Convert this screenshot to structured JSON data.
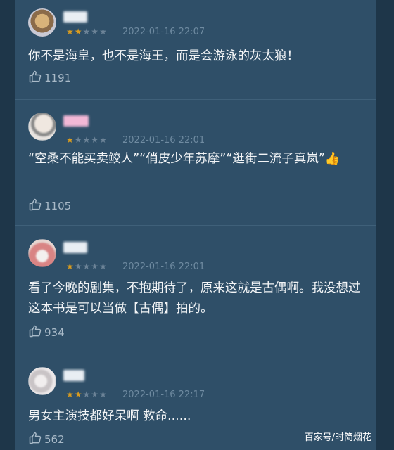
{
  "comments": [
    {
      "rating_filled": 2,
      "rating_total": 5,
      "date": "2022-01-16 22:07",
      "text": "你不是海皇，也不是海王，而是会游泳的灰太狼！",
      "likes": "1191"
    },
    {
      "rating_filled": 1,
      "rating_total": 5,
      "date": "2022-01-16 22:01",
      "text": "“空桑不能买卖鲛人”“俏皮少年苏摩”“逛街二流子真岚”👍",
      "likes": "1105"
    },
    {
      "rating_filled": 1,
      "rating_total": 5,
      "date": "2022-01-16 22:01",
      "text": "看了今晚的剧集，不抱期待了，原来这就是古偶啊。我没想过这本书是可以当做【古偶】拍的。",
      "likes": "934"
    },
    {
      "rating_filled": 2,
      "rating_total": 5,
      "date": "2022-01-16 22:17",
      "text": "男女主演技都好呆啊 救命......",
      "likes": "562"
    }
  ],
  "watermark": "百家号/时简烟花",
  "colors": {
    "background": "#2f4f68",
    "star_filled": "#d89b1f",
    "star_empty": "#6c8397",
    "date": "#6f8ba1",
    "text": "#f2f4f6"
  },
  "icons": {
    "like": "thumbs-up-icon",
    "rating": "star-icon"
  }
}
